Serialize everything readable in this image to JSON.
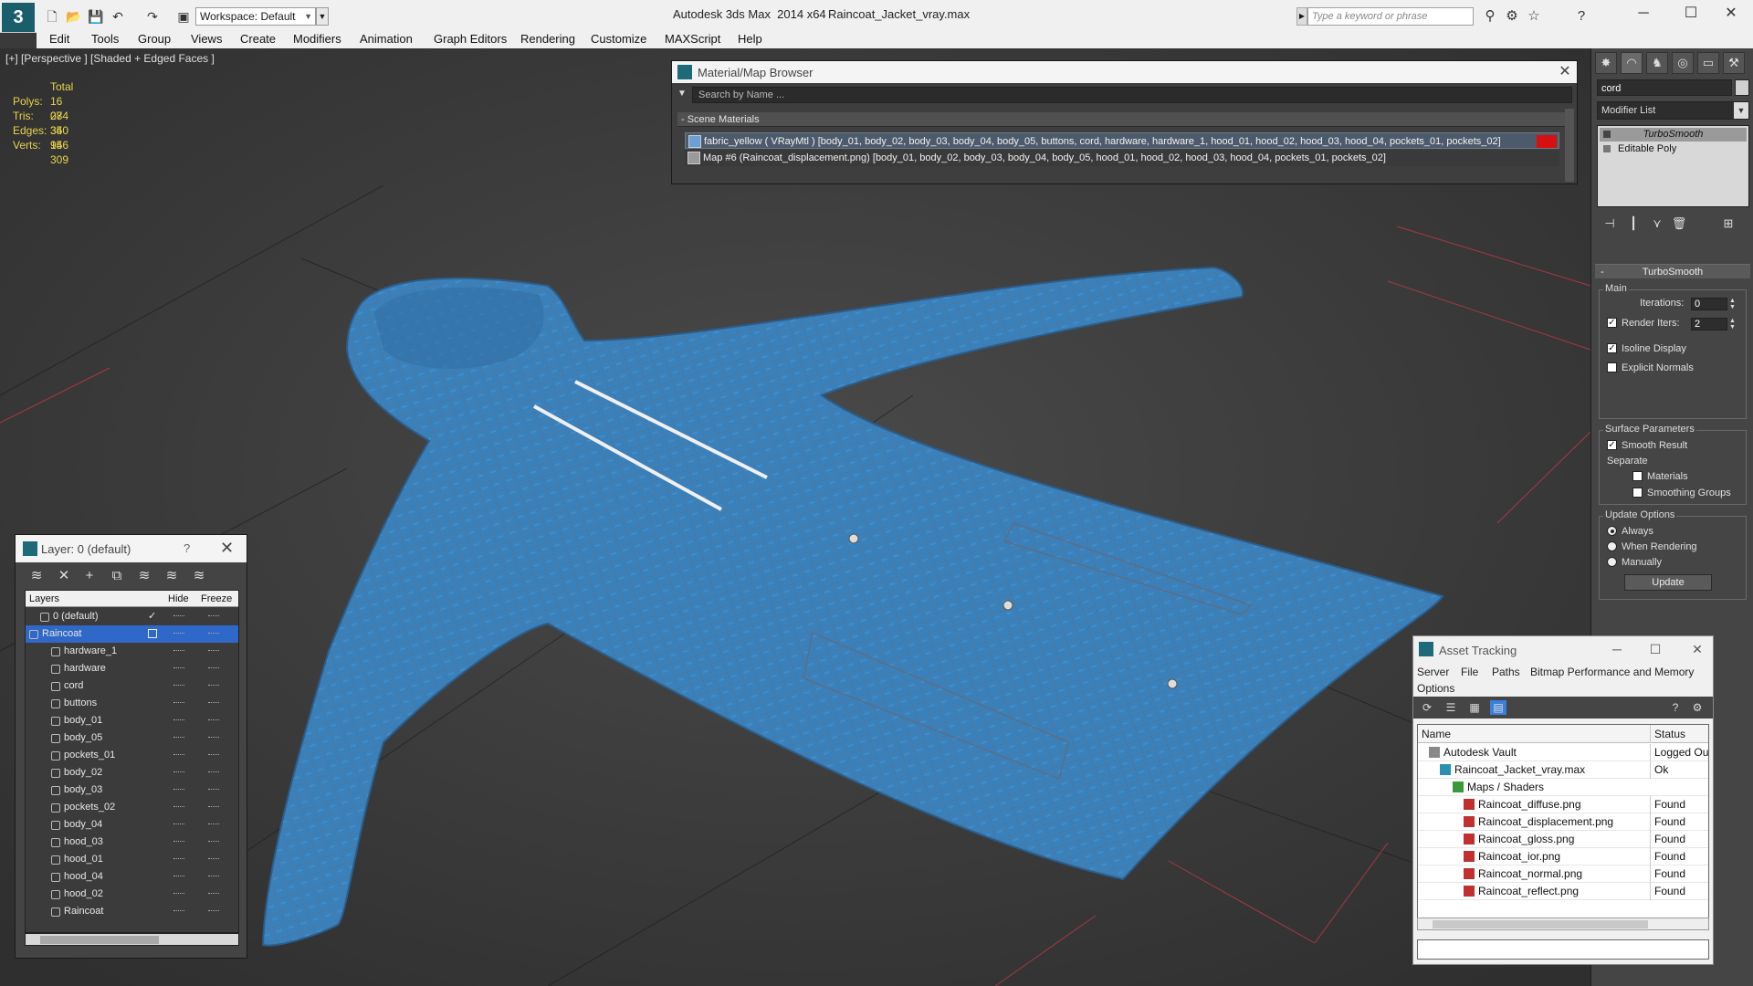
{
  "titlebar": {
    "app_title": "Autodesk 3ds Max  2014 x64",
    "file_title": "Raincoat_Jacket_vray.max",
    "workspace": "Workspace: Default",
    "search_placeholder": "Type a keyword or phrase",
    "app_logo": "3"
  },
  "menu": [
    "Edit",
    "Tools",
    "Group",
    "Views",
    "Create",
    "Modifiers",
    "Animation",
    "Graph Editors",
    "Rendering",
    "Customize",
    "MAXScript",
    "Help"
  ],
  "viewport": {
    "label": "[+] [Perspective ] [Shaded + Edged Faces ]",
    "stats_header": "Total",
    "stats": [
      {
        "k": "Polys:",
        "v": "16 074"
      },
      {
        "k": "Tris:",
        "v": "28 340"
      },
      {
        "k": "Edges:",
        "v": "35 956"
      },
      {
        "k": "Verts:",
        "v": "14 309"
      }
    ]
  },
  "material_browser": {
    "title": "Material/Map Browser",
    "search_placeholder": "Search by Name ...",
    "section": "- Scene Materials",
    "rows": [
      "fabric_yellow ( VRayMtl ) [body_01, body_02, body_03, body_04, body_05, buttons, cord, hardware, hardware_1, hood_01, hood_02, hood_03, hood_04, pockets_01, pockets_02]",
      "Map #6 (Raincoat_displacement.png) [body_01, body_02, body_03, body_04, body_05, hood_01, hood_02, hood_03, hood_04, pockets_01, pockets_02]"
    ]
  },
  "command_panel": {
    "object_name": "cord",
    "modifier_list": "Modifier List",
    "stack": [
      "TurboSmooth",
      "Editable Poly"
    ],
    "rollout_title": "TurboSmooth",
    "main_label": "Main",
    "iterations_label": "Iterations:",
    "iterations_value": "0",
    "render_iters_label": "Render Iters:",
    "render_iters_value": "2",
    "isoline_label": "Isoline Display",
    "explicit_normals_label": "Explicit Normals",
    "surface_params_label": "Surface Parameters",
    "smooth_result_label": "Smooth Result",
    "separate_label": "Separate",
    "materials_label": "Materials",
    "smoothing_groups_label": "Smoothing Groups",
    "update_options_label": "Update Options",
    "always_label": "Always",
    "when_rendering_label": "When Rendering",
    "manually_label": "Manually",
    "update_button": "Update"
  },
  "layer_panel": {
    "title": "Layer: 0 (default)",
    "help": "?",
    "col_layers": "Layers",
    "col_hide": "Hide",
    "col_freeze": "Freeze",
    "rows": [
      "0 (default)",
      "Raincoat",
      "hardware_1",
      "hardware",
      "cord",
      "buttons",
      "body_01",
      "body_05",
      "pockets_01",
      "body_02",
      "body_03",
      "pockets_02",
      "body_04",
      "hood_03",
      "hood_01",
      "hood_04",
      "hood_02",
      "Raincoat"
    ]
  },
  "asset_tracking": {
    "title": "Asset Tracking",
    "menus": [
      "Server",
      "File",
      "Paths",
      "Bitmap Performance and Memory",
      "Options"
    ],
    "col_name": "Name",
    "col_status": "Status",
    "rows": [
      {
        "name": "Autodesk Vault",
        "status": "Logged Out"
      },
      {
        "name": "Raincoat_Jacket_vray.max",
        "status": "Ok"
      },
      {
        "name": "Maps / Shaders",
        "status": ""
      },
      {
        "name": "Raincoat_diffuse.png",
        "status": "Found"
      },
      {
        "name": "Raincoat_displacement.png",
        "status": "Found"
      },
      {
        "name": "Raincoat_gloss.png",
        "status": "Found"
      },
      {
        "name": "Raincoat_ior.png",
        "status": "Found"
      },
      {
        "name": "Raincoat_normal.png",
        "status": "Found"
      },
      {
        "name": "Raincoat_reflect.png",
        "status": "Found"
      }
    ]
  },
  "colors": {
    "coat_blue": "#3a7fb8",
    "selection_blue": "#2f68c8",
    "material_red": "#d61010",
    "stats_yellow": "#e8d44d"
  }
}
